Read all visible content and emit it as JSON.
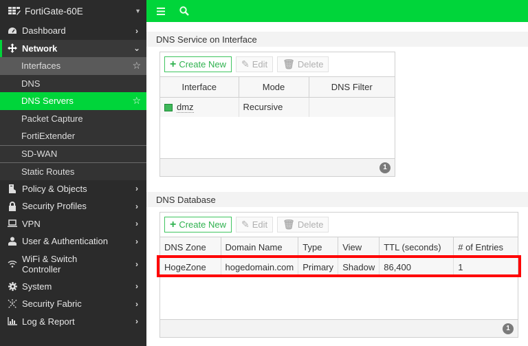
{
  "sidebar": {
    "device_name": "FortiGate-60E",
    "items": [
      {
        "label": "Dashboard",
        "icon": "dashboard-icon"
      },
      {
        "label": "Network",
        "icon": "network-move-icon",
        "expanded": true
      },
      {
        "label": "Policy & Objects",
        "icon": "policy-icon"
      },
      {
        "label": "Security Profiles",
        "icon": "lock-icon"
      },
      {
        "label": "VPN",
        "icon": "laptop-icon"
      },
      {
        "label": "User & Authentication",
        "icon": "user-icon"
      },
      {
        "label": "WiFi & Switch",
        "label2": "Controller",
        "icon": "wifi-icon"
      },
      {
        "label": "System",
        "icon": "gear-icon"
      },
      {
        "label": "Security Fabric",
        "icon": "fabric-icon"
      },
      {
        "label": "Log & Report",
        "icon": "chart-icon"
      }
    ],
    "network_sub": [
      {
        "label": "Interfaces",
        "starred": true
      },
      {
        "label": "DNS"
      },
      {
        "label": "DNS Servers",
        "active": true,
        "starred": true
      },
      {
        "label": "Packet Capture"
      },
      {
        "label": "FortiExtender"
      },
      {
        "label": "SD-WAN"
      },
      {
        "label": "Static Routes"
      }
    ]
  },
  "topbar": {
    "menu_icon": "hamburger-icon",
    "search_icon": "search-icon"
  },
  "colors": {
    "accent": "#00d53a",
    "highlight": "#ff0000",
    "sidebar_bg": "#2b2b2b"
  },
  "dns_service": {
    "title": "DNS Service on Interface",
    "toolbar": {
      "create": "Create New",
      "edit": "Edit",
      "delete": "Delete"
    },
    "columns": [
      "Interface",
      "Mode",
      "DNS Filter"
    ],
    "rows": [
      {
        "interface": "dmz",
        "mode": "Recursive",
        "dns_filter": ""
      }
    ],
    "count": "1"
  },
  "dns_database": {
    "title": "DNS Database",
    "toolbar": {
      "create": "Create New",
      "edit": "Edit",
      "delete": "Delete"
    },
    "columns": [
      "DNS Zone",
      "Domain Name",
      "Type",
      "View",
      "TTL (seconds)",
      "# of Entries"
    ],
    "rows": [
      {
        "zone": "HogeZone",
        "domain": "hogedomain.com",
        "type": "Primary",
        "view": "Shadow",
        "ttl": "86,400",
        "entries": "1"
      }
    ],
    "count": "1"
  }
}
